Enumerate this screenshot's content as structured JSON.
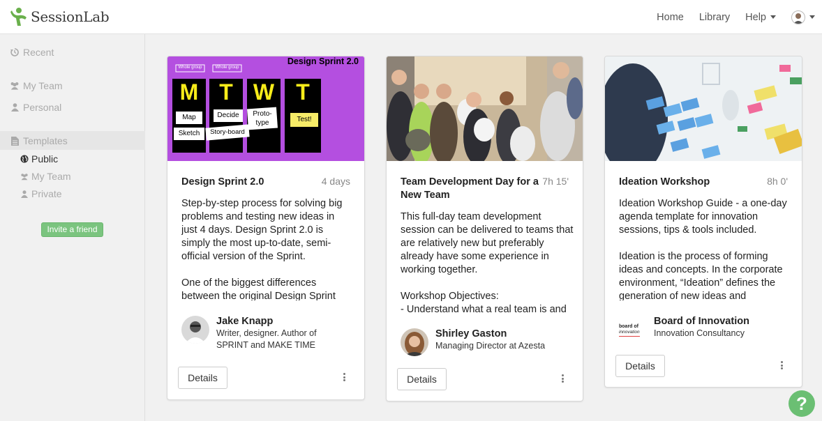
{
  "brand": {
    "name": "SessionLab",
    "color": "#6ab04c"
  },
  "nav": {
    "home": "Home",
    "library": "Library",
    "help": "Help"
  },
  "sidebar": {
    "recent": "Recent",
    "my_team": "My Team",
    "personal": "Personal",
    "templates": "Templates",
    "sub": {
      "public": "Public",
      "my_team": "My Team",
      "private": "Private"
    },
    "invite": "Invite a friend"
  },
  "cards": [
    {
      "title": "Design Sprint 2.0",
      "duration": "4 days",
      "description": "Step-by-step process for solving big problems and testing new ideas in just 4 days. Design Sprint 2.0 is simply the most up-to-date, semi-official version of the Sprint.\n\nOne of the biggest differences between the original Design Sprint",
      "author_name": "Jake Knapp",
      "author_role": "Writer, designer. Author of SPRINT and MAKE TIME",
      "details": "Details",
      "image": {
        "heading": "Design Sprint 2.0",
        "tag1": "Whole group",
        "tag2": "Whole group",
        "letters": [
          "M",
          "T",
          "W",
          "T"
        ],
        "notes": [
          "Map",
          "Decide",
          "Proto-type",
          "Test!",
          "Sketch",
          "Story-board"
        ]
      }
    },
    {
      "title": "Team Development Day for a New Team",
      "duration": "7h 15'",
      "description": "This full-day team development session can be delivered to teams that are relatively new but preferably already have some experience in working together.\n\nWorkshop Objectives:\n- Understand what a real team is and",
      "author_name": "Shirley Gaston",
      "author_role": "Managing Director at Azesta",
      "details": "Details"
    },
    {
      "title": "Ideation Workshop",
      "duration": "8h 0'",
      "description": "Ideation Workshop Guide - a one-day agenda template for innovation sessions, tips & tools included.\n\nIdeation is the process of forming ideas and concepts. In the corporate environment, “Ideation” defines the generation of new ideas and",
      "author_name": "Board of Innovation",
      "author_role": "Innovation Consultancy",
      "details": "Details",
      "author_logo": {
        "line1": "board of",
        "line2": "innovation"
      }
    }
  ],
  "help_label": "?"
}
